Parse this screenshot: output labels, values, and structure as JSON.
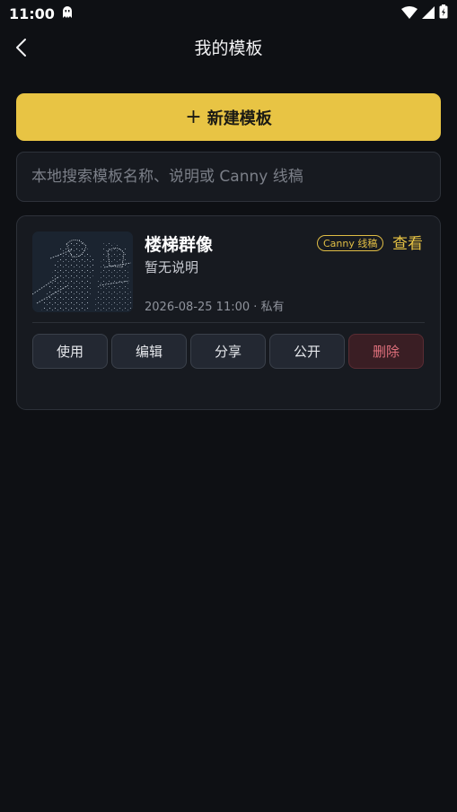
{
  "status_bar": {
    "time": "11:00",
    "app_icon": "ghost-icon"
  },
  "header": {
    "title": "我的模板",
    "back_icon": "chevron-left-icon"
  },
  "new_button": {
    "icon": "+",
    "label": "新建模板"
  },
  "search": {
    "placeholder": "本地搜索模板名称、说明或 Canny 线稿",
    "value": ""
  },
  "templates": [
    {
      "name": "楼梯群像",
      "description": "暂无说明",
      "badge": "Canny 线稿",
      "view_label": "查看",
      "meta": "2026-08-25 11:00 · 私有",
      "actions": [
        "使用",
        "编辑",
        "分享",
        "公开",
        "删除"
      ]
    }
  ],
  "colors": {
    "background": "#0e1014",
    "accent": "#e8c444",
    "card": "#171a20",
    "danger_text": "#e0707c"
  }
}
